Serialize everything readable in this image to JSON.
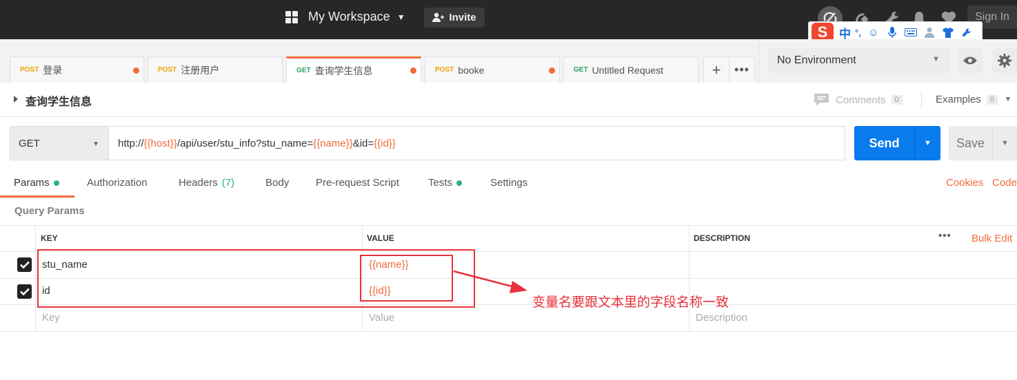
{
  "topbar": {
    "workspace_label": "My Workspace",
    "invite_label": "Invite",
    "signin_label": "Sign In",
    "icons": [
      "sync-icon",
      "satellite-icon",
      "wrench-icon",
      "bell-icon",
      "heart-icon"
    ]
  },
  "ime_toolbar": {
    "logo": "S",
    "mode": "中",
    "punct": "°,",
    "icons": [
      "emoji-icon",
      "mic-icon",
      "keyboard-icon",
      "user-icon",
      "shirt-icon",
      "wrench-icon"
    ]
  },
  "tabs": [
    {
      "method": "POST",
      "name": "登录",
      "unsaved": true
    },
    {
      "method": "POST",
      "name": "注册用户",
      "unsaved": false
    },
    {
      "method": "GET",
      "name": "查询学生信息",
      "unsaved": true,
      "active": true
    },
    {
      "method": "POST",
      "name": "booke",
      "unsaved": true
    },
    {
      "method": "GET",
      "name": "Untitled Request",
      "unsaved": false
    }
  ],
  "tab_actions": {
    "add": "+",
    "more": "•••"
  },
  "environment": {
    "selected": "No Environment"
  },
  "request": {
    "title": "查询学生信息",
    "comments_label": "Comments",
    "comments_count": "0",
    "examples_label": "Examples",
    "examples_count": "0",
    "method": "GET",
    "url_parts": [
      "http://",
      "{{host}}",
      "/api/user/stu_info?stu_name=",
      "{{name}}",
      "&id=",
      "{{id}}"
    ],
    "send_label": "Send",
    "save_label": "Save"
  },
  "request_tabs": {
    "params": "Params",
    "authorization": "Authorization",
    "headers": "Headers",
    "headers_count": "(7)",
    "body": "Body",
    "prerequest": "Pre-request Script",
    "tests": "Tests",
    "settings": "Settings",
    "cookies": "Cookies",
    "code": "Code"
  },
  "query_params": {
    "section_title": "Query Params",
    "headers": {
      "key": "KEY",
      "value": "VALUE",
      "description": "DESCRIPTION"
    },
    "bulk_edit": "Bulk Edit",
    "rows": [
      {
        "checked": true,
        "key": "stu_name",
        "value": "{{name}}",
        "description": ""
      },
      {
        "checked": true,
        "key": "id",
        "value": "{{id}}",
        "description": ""
      }
    ],
    "placeholders": {
      "key": "Key",
      "value": "Value",
      "description": "Description"
    }
  },
  "annotation": {
    "note": "变量名要跟文本里的字段名称一致",
    "color": "#e8303a"
  },
  "colors": {
    "accent": "#f26b3a",
    "send_blue": "#097bed",
    "post_method": "#f0a100",
    "get_method": "#2e9d5e",
    "active_dot": "#26b47f"
  }
}
